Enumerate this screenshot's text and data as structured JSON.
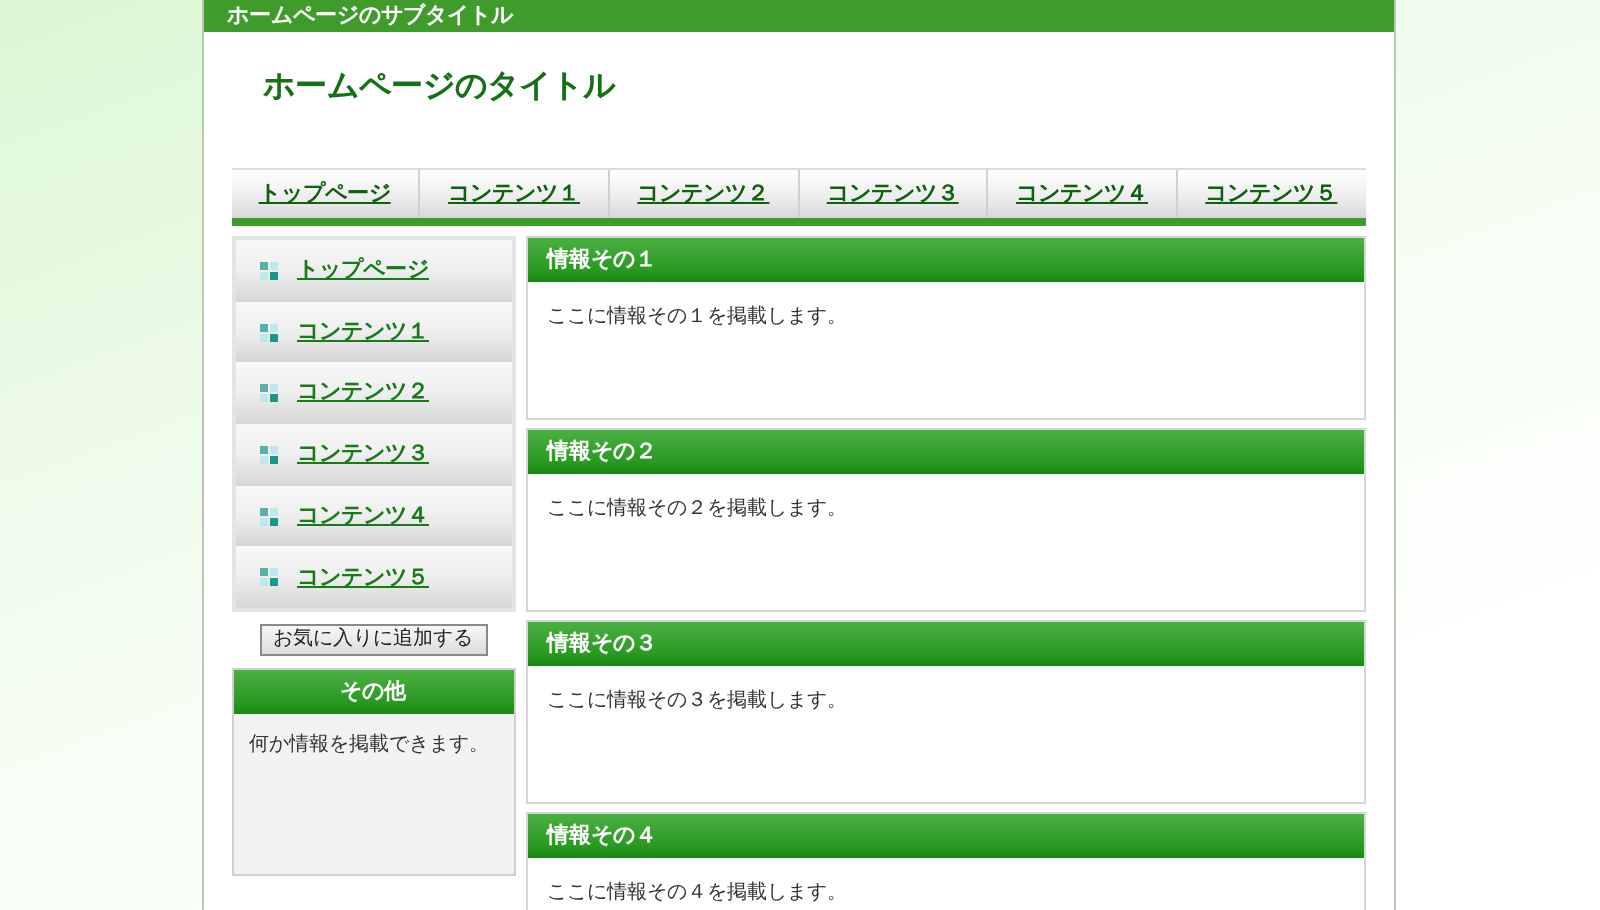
{
  "header": {
    "subtitle": "ホームページのサブタイトル",
    "title": "ホームページのタイトル"
  },
  "nav": [
    "トップページ",
    "コンテンツ１",
    "コンテンツ２",
    "コンテンツ３",
    "コンテンツ４",
    "コンテンツ５"
  ],
  "side_menu": [
    "トップページ",
    "コンテンツ１",
    "コンテンツ２",
    "コンテンツ３",
    "コンテンツ４",
    "コンテンツ５"
  ],
  "bookmark_button": "お気に入りに追加する",
  "side_box": {
    "title": "その他",
    "text": "何か情報を掲載できます。"
  },
  "info_boxes": [
    {
      "title": "情報その１",
      "text": "ここに情報その１を掲載します。"
    },
    {
      "title": "情報その２",
      "text": "ここに情報その２を掲載します。"
    },
    {
      "title": "情報その３",
      "text": "ここに情報その３を掲載します。"
    },
    {
      "title": "情報その４",
      "text": "ここに情報その４を掲載します。"
    }
  ]
}
